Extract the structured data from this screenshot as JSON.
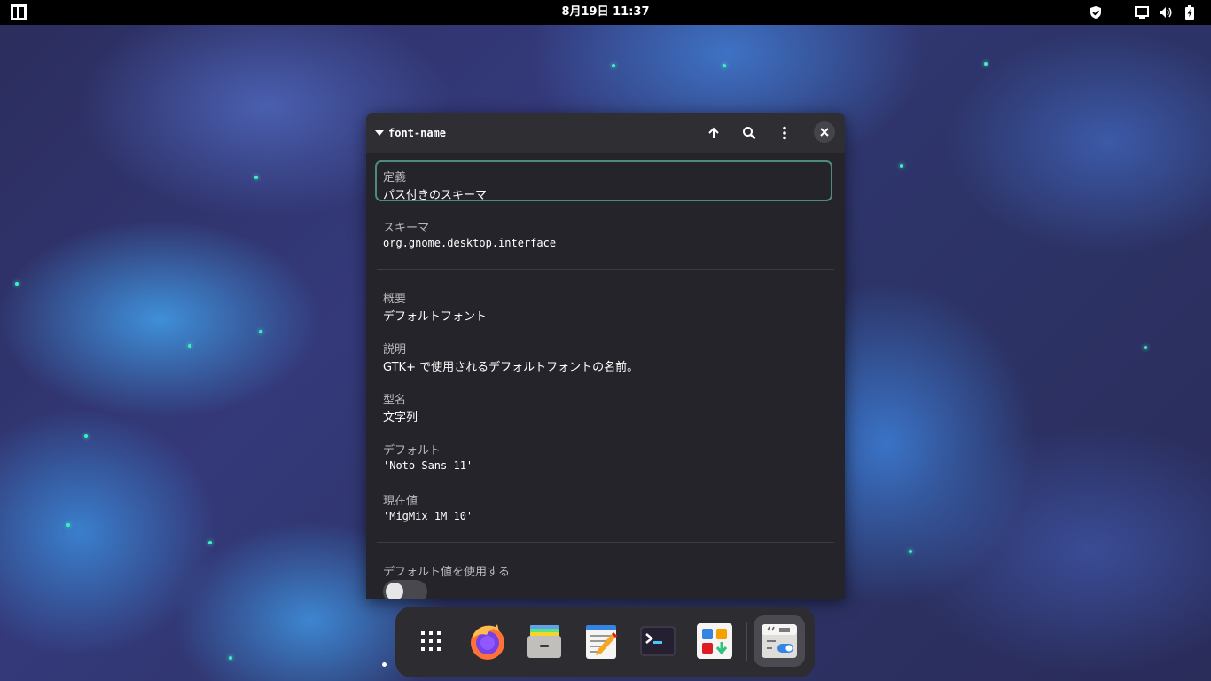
{
  "topbar": {
    "clock": "8月19日 11:37",
    "icons": [
      "activities-logo-icon",
      "security-shield-icon",
      "display-icon",
      "volume-icon",
      "battery-icon"
    ]
  },
  "window": {
    "title": "font-name",
    "header_buttons": [
      "go-up-icon",
      "search-icon",
      "menu-icon",
      "close-icon"
    ],
    "fields": {
      "definition": {
        "label": "定義",
        "value": "パス付きのスキーマ"
      },
      "schema": {
        "label": "スキーマ",
        "value": "org.gnome.desktop.interface"
      },
      "summary": {
        "label": "概要",
        "value": "デフォルトフォント"
      },
      "description": {
        "label": "説明",
        "value": "GTK+ で使用されるデフォルトフォントの名前。"
      },
      "type": {
        "label": "型名",
        "value": "文字列"
      },
      "default": {
        "label": "デフォルト",
        "value": "'Noto Sans 11'"
      },
      "current": {
        "label": "現在値",
        "value": "'MigMix 1M 10'"
      },
      "use_default": {
        "label": "デフォルト値を使用する",
        "enabled": false
      }
    }
  },
  "dock": {
    "items": [
      "app-grid-icon",
      "firefox-icon",
      "files-icon",
      "text-editor-icon",
      "terminal-icon",
      "software-icon",
      "dconf-editor-icon"
    ],
    "active": "dconf-editor-icon"
  },
  "colors": {
    "accent": "#4f8a80",
    "window_bg": "#24242a",
    "header_bg": "#2e2e33"
  }
}
